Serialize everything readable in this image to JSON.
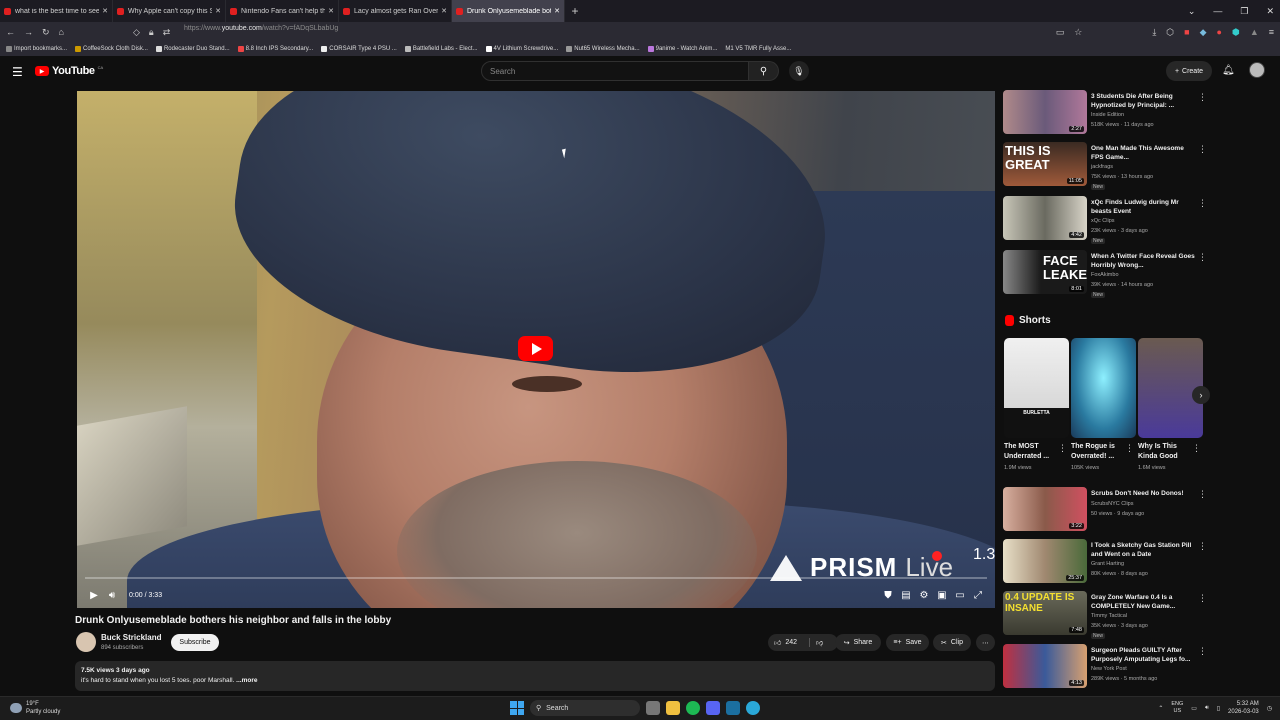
{
  "browser": {
    "tabs": [
      {
        "title": "what is the best time to see the",
        "active": false
      },
      {
        "title": "Why Apple can't copy this Sam",
        "active": false
      },
      {
        "title": "Nintendo Fans can't help them",
        "active": false
      },
      {
        "title": "Lacy almost gets Ran Over... - Y",
        "active": false
      },
      {
        "title": "Drunk Onlyusemeblade bothers",
        "active": true
      }
    ],
    "new_tab": "+",
    "url_prefix": "https://www.",
    "url_domain": "youtube.com",
    "url_path": "/watch?v=fADqSLbabUg",
    "bookmarks": [
      "Import bookmarks...",
      "CoffeeSock Cloth Disk...",
      "Rodecaster Duo Stand...",
      "8.8 Inch IPS Secondary...",
      "CORSAIR Type 4 PSU ...",
      "Battlefield Labs - Elect...",
      "4V Lithium Screwdrive...",
      "Nut65 Wireless Mecha...",
      "9anime - Watch Anim...",
      "M1 V5 TMR Fully Asse..."
    ]
  },
  "youtube": {
    "logo_text": "YouTube",
    "country_code": "CA",
    "search_placeholder": "Search",
    "create_label": "Create"
  },
  "video": {
    "title": "Drunk Onlyusemeblade bothers his neighbor and falls in the lobby",
    "time": "0:00 / 3:33",
    "progress": 0,
    "overlay_brand": "PRISM",
    "overlay_live": "Live",
    "overlay_count": "1.3",
    "channel": "Buck Strickland",
    "subscribers": "894 subscribers",
    "subscribe_label": "Subscribe",
    "likes": "242",
    "share_label": "Share",
    "save_label": "Save",
    "clip_label": "Clip",
    "views_date": "7.5K views  3 days ago",
    "description": "it's hard to stand when you lost 5 toes. poor Marshall.",
    "more_label": "...more"
  },
  "recommended": [
    {
      "title": "3 Students Die After Being Hypnotized by Principal: ...",
      "channel": "Inside Edition",
      "meta": "518K views · 11 days ago",
      "duration": "2:27",
      "new": false,
      "thumb_color": "#8a6a7a"
    },
    {
      "title": "One Man Made This Awesome FPS Game...",
      "channel": "jackfrags",
      "meta": "75K views · 13 hours ago",
      "duration": "11:05",
      "new": true,
      "thumb_color": "#7a5040",
      "thumb_text": "THIS IS GREAT"
    },
    {
      "title": "xQc Finds Ludwig during Mr beasts Event",
      "channel": "xQc Clips",
      "meta": "23K views · 3 days ago",
      "duration": "4:42",
      "new": true,
      "thumb_color": "#9a9a90"
    },
    {
      "title": "When A Twitter Face Reveal Goes Horribly Wrong...",
      "channel": "FoxAkimbo",
      "meta": "39K views · 14 hours ago",
      "duration": "8:01",
      "new": true,
      "thumb_color": "#2a2a2a",
      "thumb_text": "FACE LEAKED"
    }
  ],
  "shorts": {
    "heading": "Shorts",
    "items": [
      {
        "title": "The MOST Underrated ...",
        "views": "1.9M views",
        "color": "#e8e8e8",
        "label": "BURLETTA"
      },
      {
        "title": "The Rogue is Overrated! ...",
        "views": "105K views",
        "color": "#3aa6c8"
      },
      {
        "title": "Why Is This Kinda Good",
        "views": "1.6M views",
        "color": "#5a4a8a"
      }
    ]
  },
  "recommended2": [
    {
      "title": "Scrubs Don't Need No Donos!",
      "channel": "ScrubsNYC Clips",
      "meta": "50 views · 9 days ago",
      "duration": "3:22",
      "new": false,
      "thumb_color": "#b07060"
    },
    {
      "title": "I Took a Sketchy Gas Station Pill and Went on a Date",
      "channel": "Grant Harting",
      "meta": "80K views · 8 days ago",
      "duration": "25:37",
      "new": false,
      "thumb_color": "#c8c0a0"
    },
    {
      "title": "Gray Zone Warfare 0.4 Is a COMPLETELY New Game...",
      "channel": "Timmy Tactical",
      "meta": "35K views · 3 days ago",
      "duration": "7:48",
      "new": true,
      "thumb_color": "#6a6a5a",
      "thumb_text": "0.4 UPDATE IS INSANE"
    },
    {
      "title": "Surgeon Pleads GUILTY After Purposely Amputating Legs fo...",
      "channel": "New York Post",
      "meta": "289K views · 5 months ago",
      "duration": "4:13",
      "new": false,
      "thumb_color": "#4a6aa0"
    }
  ],
  "taskbar": {
    "temp": "19°F",
    "weather": "Partly cloudy",
    "search": "Search",
    "lang1": "ENG",
    "lang2": "US",
    "time": "5:32 AM",
    "date": "2026-03-03"
  }
}
